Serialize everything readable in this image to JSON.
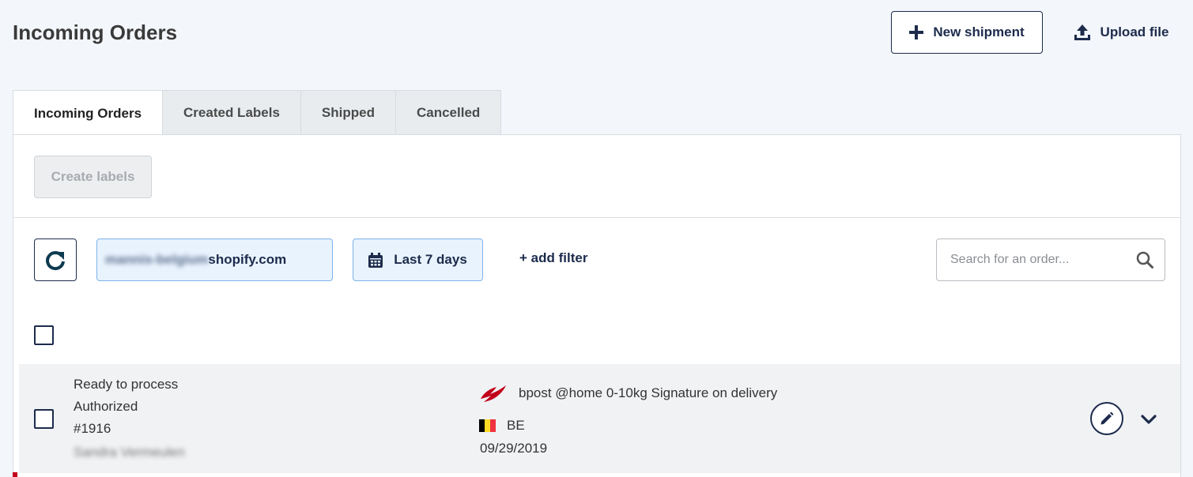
{
  "header": {
    "title": "Incoming Orders",
    "new_shipment_label": "New shipment",
    "upload_label": "Upload file"
  },
  "tabs": [
    {
      "label": "Incoming Orders",
      "active": true
    },
    {
      "label": "Created Labels",
      "active": false
    },
    {
      "label": "Shipped",
      "active": false
    },
    {
      "label": "Cancelled",
      "active": false
    }
  ],
  "toolbar": {
    "create_labels_label": "Create labels",
    "create_labels_disabled": true
  },
  "filters": {
    "store_blurred": "mannis-belgium",
    "store_suffix": "shopify.com",
    "date_range": "Last 7 days",
    "add_filter_label": "+ add filter",
    "search_placeholder": "Search for an order..."
  },
  "orders": [
    {
      "status": "Ready to process",
      "payment": "Authorized",
      "number": "#1916",
      "customer_blurred": "Sandra Vermeulen",
      "service": "bpost @home 0-10kg Signature on delivery",
      "country": "BE",
      "date": "09/29/2019"
    }
  ],
  "colors": {
    "brand_navy": "#1d2b4c",
    "chip_bg": "#e8f3fd",
    "chip_border": "#7fb3e8",
    "bpost_red": "#c2001a",
    "page_bg": "#f3f6fb"
  },
  "icons": {
    "new_shipment": "plus-icon",
    "upload": "upload-icon",
    "refresh": "refresh-icon",
    "calendar": "calendar-icon",
    "search": "search-icon",
    "carrier": "bpost-logo-icon",
    "country_flag": "belgium-flag-icon",
    "edit": "pencil-icon",
    "expand": "chevron-down-icon"
  }
}
